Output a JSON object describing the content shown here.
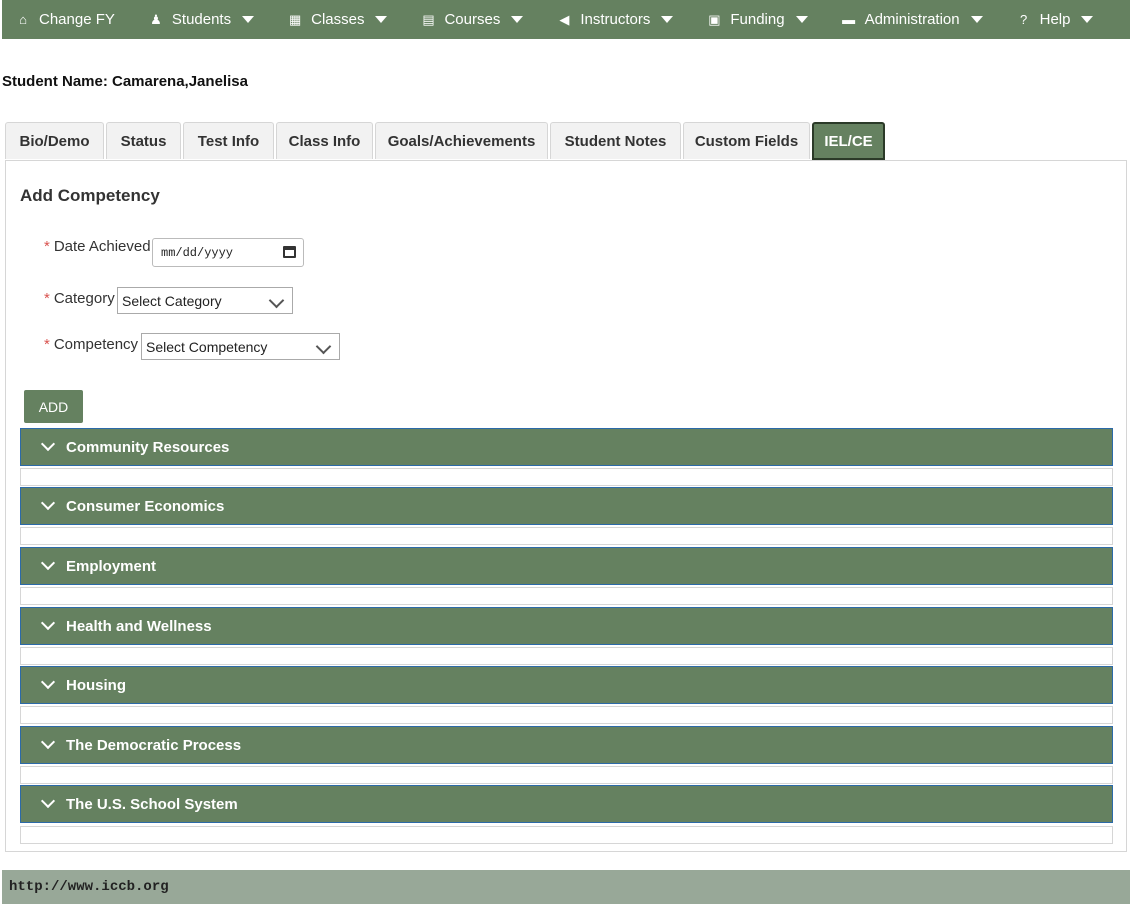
{
  "nav": {
    "items": [
      {
        "label": "Change FY",
        "icon": "home-icon",
        "glyph": "⌂",
        "caret": false
      },
      {
        "label": "Students",
        "icon": "person-icon",
        "glyph": "♟",
        "caret": true
      },
      {
        "label": "Classes",
        "icon": "building-icon",
        "glyph": "▦",
        "caret": true
      },
      {
        "label": "Courses",
        "icon": "book-icon",
        "glyph": "▤",
        "caret": true
      },
      {
        "label": "Instructors",
        "icon": "bullhorn-icon",
        "glyph": "◀",
        "caret": true
      },
      {
        "label": "Funding",
        "icon": "money-icon",
        "glyph": "▣",
        "caret": true
      },
      {
        "label": "Administration",
        "icon": "folder-icon",
        "glyph": "▬",
        "caret": true
      },
      {
        "label": "Help",
        "icon": "question-icon",
        "glyph": "?",
        "caret": true
      }
    ]
  },
  "student": {
    "label": "Student Name: Camarena,Janelisa"
  },
  "tabs": [
    {
      "label": "Bio/Demo",
      "active": false
    },
    {
      "label": "Status",
      "active": false
    },
    {
      "label": "Test Info",
      "active": false
    },
    {
      "label": "Class Info",
      "active": false
    },
    {
      "label": "Goals/Achievements",
      "active": false
    },
    {
      "label": "Student Notes",
      "active": false
    },
    {
      "label": "Custom Fields",
      "active": false
    },
    {
      "label": "IEL/CE",
      "active": true
    }
  ],
  "form": {
    "title": "Add Competency",
    "required_mark": "*",
    "date_label": "Date Achieved",
    "date_placeholder": "mm/dd/yyyy",
    "category_label": "Category",
    "category_value": "Select Category",
    "competency_label": "Competency",
    "competency_value": "Select Competency",
    "add_label": "ADD"
  },
  "accordion": [
    "Community Resources",
    "Consumer Economics",
    "Employment",
    "Health and Wellness",
    "Housing",
    "The Democratic Process",
    "The U.S. School System"
  ],
  "footer": {
    "url": "http://www.iccb.org"
  },
  "colors": {
    "primary": "#658160",
    "footer": "#98a898",
    "required": "#d9534f",
    "accordion_border": "#2c6aa8"
  }
}
